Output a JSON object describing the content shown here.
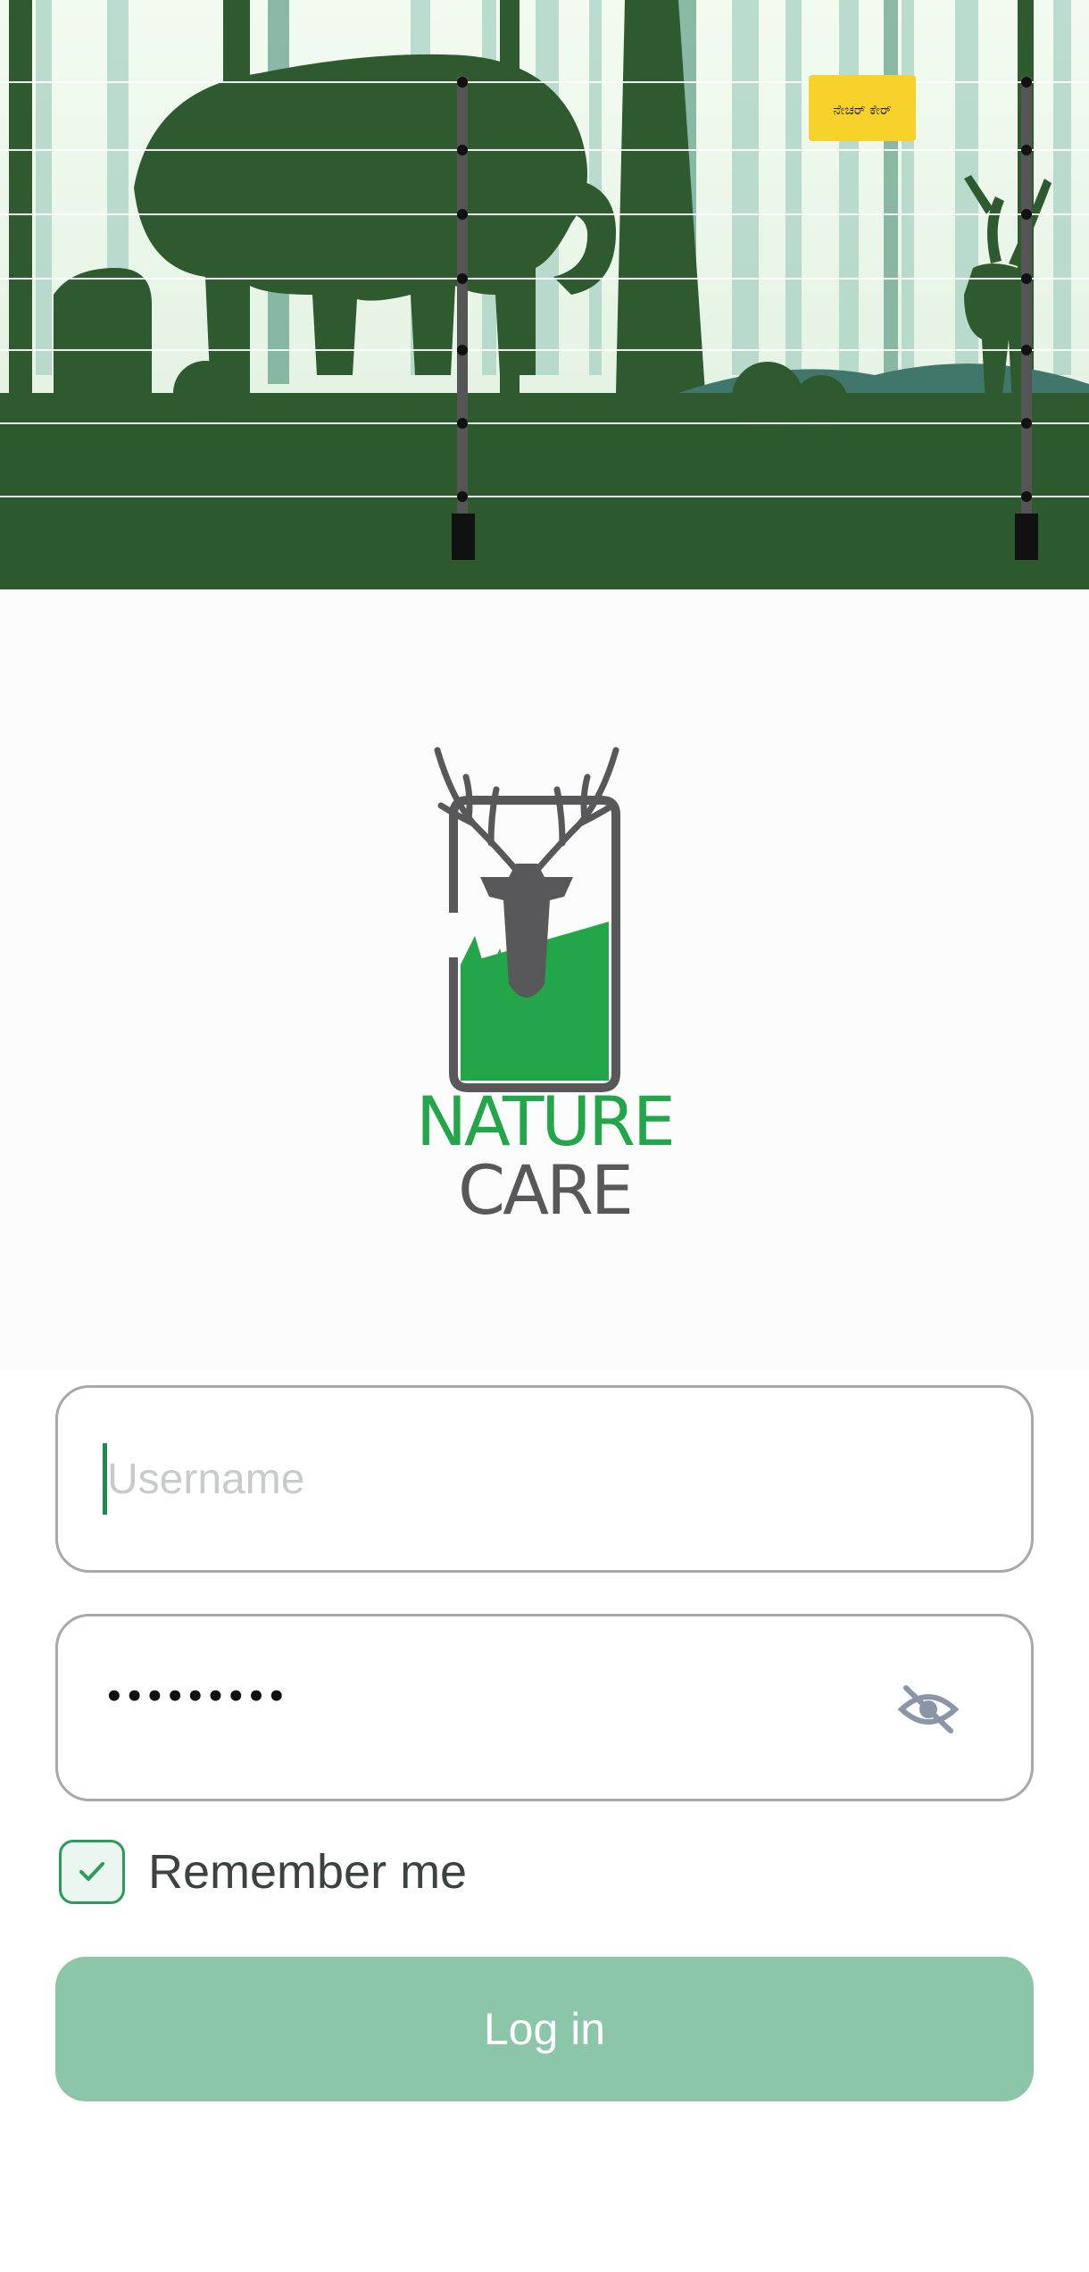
{
  "brand": {
    "line1": "NATURE",
    "line2": "CARE",
    "colors": {
      "green": "#23a54a",
      "gray": "#58585a"
    }
  },
  "banner": {
    "sign_text": "ನೇಚರ್ ಕೇರ್"
  },
  "form": {
    "username": {
      "placeholder": "Username",
      "value": ""
    },
    "password": {
      "masked_value": "•••••••••",
      "toggle_icon": "eye-off-icon"
    },
    "remember": {
      "label": "Remember me",
      "checked": true
    },
    "login_label": "Log in"
  },
  "colors": {
    "accent": "#2b9b5a",
    "button": "#8bc6a8",
    "field_border": "#a5a9a7",
    "forest": "#2f5a30"
  }
}
